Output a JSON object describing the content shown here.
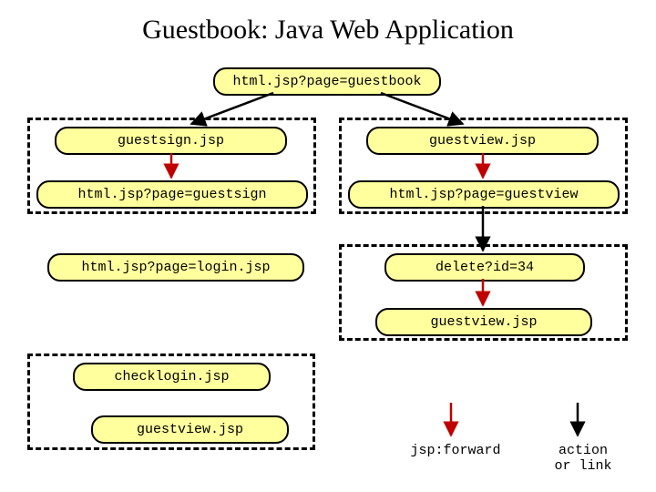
{
  "title": "Guestbook: Java Web Application",
  "nodes": {
    "top": "html.jsp?page=guestbook",
    "guestsign": "guestsign.jsp",
    "guestview_top": "guestview.jsp",
    "page_guestsign": "html.jsp?page=guestsign",
    "page_guestview": "html.jsp?page=guestview",
    "login": "html.jsp?page=login.jsp",
    "delete": "delete?id=34",
    "guestview_after_delete": "guestview.jsp",
    "checklogin": "checklogin.jsp",
    "guestview_bottom": "guestview.jsp"
  },
  "legend": {
    "forward": "jsp:forward",
    "action": "action\nor link"
  }
}
